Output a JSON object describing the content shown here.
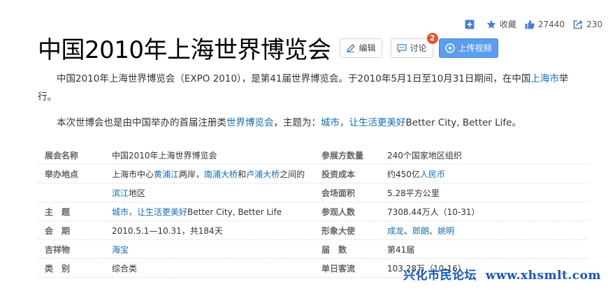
{
  "toolbar": {
    "add_label": "",
    "favorite_label": "收藏",
    "like_count": "27440",
    "share_count": "230"
  },
  "title": "中国2010年上海世界博览会",
  "buttons": {
    "edit": "编辑",
    "discuss": "讨论",
    "discuss_badge": "2",
    "upload": "上传视频"
  },
  "intro": {
    "p1_a": "中国2010年上海世界博览会（EXPO 2010），是第41届世界博览会。于2010年5月1日至10月31日期间，在中国",
    "p1_link": "上海市",
    "p1_b": "举行。",
    "p2_a": "本次世博会也是由中国举办的首届注册类",
    "p2_link1": "世界博览会",
    "p2_b": "，主题为：",
    "p2_link2": "城市，让生活更美好",
    "p2_c": "Better City, Better Life。"
  },
  "info": {
    "r1": {
      "k": "展会名称",
      "v": "中国2010年上海世界博览会",
      "k2": "参展方数量",
      "v2": "240个国家地区组织"
    },
    "r2": {
      "k": "举办地点",
      "v_a": "上海市中心",
      "v_l1": "黄浦江",
      "v_b": "两岸，",
      "v_l2": "南浦大桥",
      "v_c": "和",
      "v_l3": "卢浦大桥",
      "v_d": "之间的",
      "k2": "投资成本",
      "v2_a": "约450亿",
      "v2_l": "人民币"
    },
    "r3": {
      "k": "",
      "v_l": "滨江",
      "v_b": "地区",
      "k2": "会场面积",
      "v2": "5.28平方公里"
    },
    "r4": {
      "k": "主　题",
      "v_l": "城市，让生活更美好",
      "v_b": "Better City, Better Life",
      "k2": "参观人数",
      "v2": "7308.44万人（10-31）"
    },
    "r5": {
      "k": "会　期",
      "v": "2010.5.1—10.31，共184天",
      "k2": "形象大使",
      "v2_l1": "成龙",
      "v2_s1": "、",
      "v2_l2": "郎朗",
      "v2_s2": "、",
      "v2_l3": "姚明"
    },
    "r6": {
      "k": "吉祥物",
      "v_l": "海宝",
      "k2": "届　数",
      "v2": "第41届"
    },
    "r7": {
      "k": "类　别",
      "v": "综合类",
      "k2": "单日客流",
      "v2": "103.28万（10-16）"
    }
  },
  "watermark": "兴化市民论坛  www.xhsmlt.com"
}
